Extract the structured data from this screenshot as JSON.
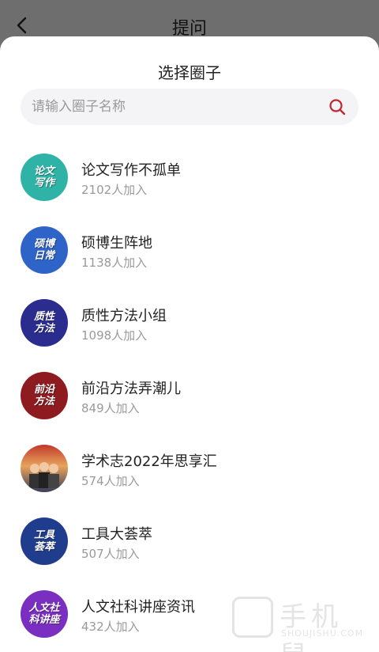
{
  "header": {
    "title": "提问"
  },
  "sheet": {
    "title": "选择圈子"
  },
  "search": {
    "placeholder": "请输入圈子名称"
  },
  "circles": [
    {
      "name": "论文写作不孤单",
      "members": "2102人加入",
      "avatar_text": "论文\n写作",
      "avatar_color": "#2fb3a7"
    },
    {
      "name": "硕博生阵地",
      "members": "1138人加入",
      "avatar_text": "硕博\n日常",
      "avatar_color": "#2e63c8"
    },
    {
      "name": "质性方法小组",
      "members": "1098人加入",
      "avatar_text": "质性\n方法",
      "avatar_color": "#2a2d8e"
    },
    {
      "name": "前沿方法弄潮儿",
      "members": "849人加入",
      "avatar_text": "前沿\n方法",
      "avatar_color": "#8d1b1f"
    },
    {
      "name": "学术志2022年思享汇",
      "members": "574人加入",
      "avatar_text": "",
      "avatar_color": "#c0392b"
    },
    {
      "name": "工具大荟萃",
      "members": "507人加入",
      "avatar_text": "工具\n荟萃",
      "avatar_color": "#203c8c"
    },
    {
      "name": "人文社科讲座资讯",
      "members": "432人加入",
      "avatar_text": "人文社\n科讲座",
      "avatar_color": "#7a2fc0"
    }
  ],
  "watermark": {
    "text": "手机鼠",
    "sub": "SHOUJISHU.COM"
  },
  "colors": {
    "accent": "#c0282f",
    "overlay": "#6e6e6e"
  }
}
